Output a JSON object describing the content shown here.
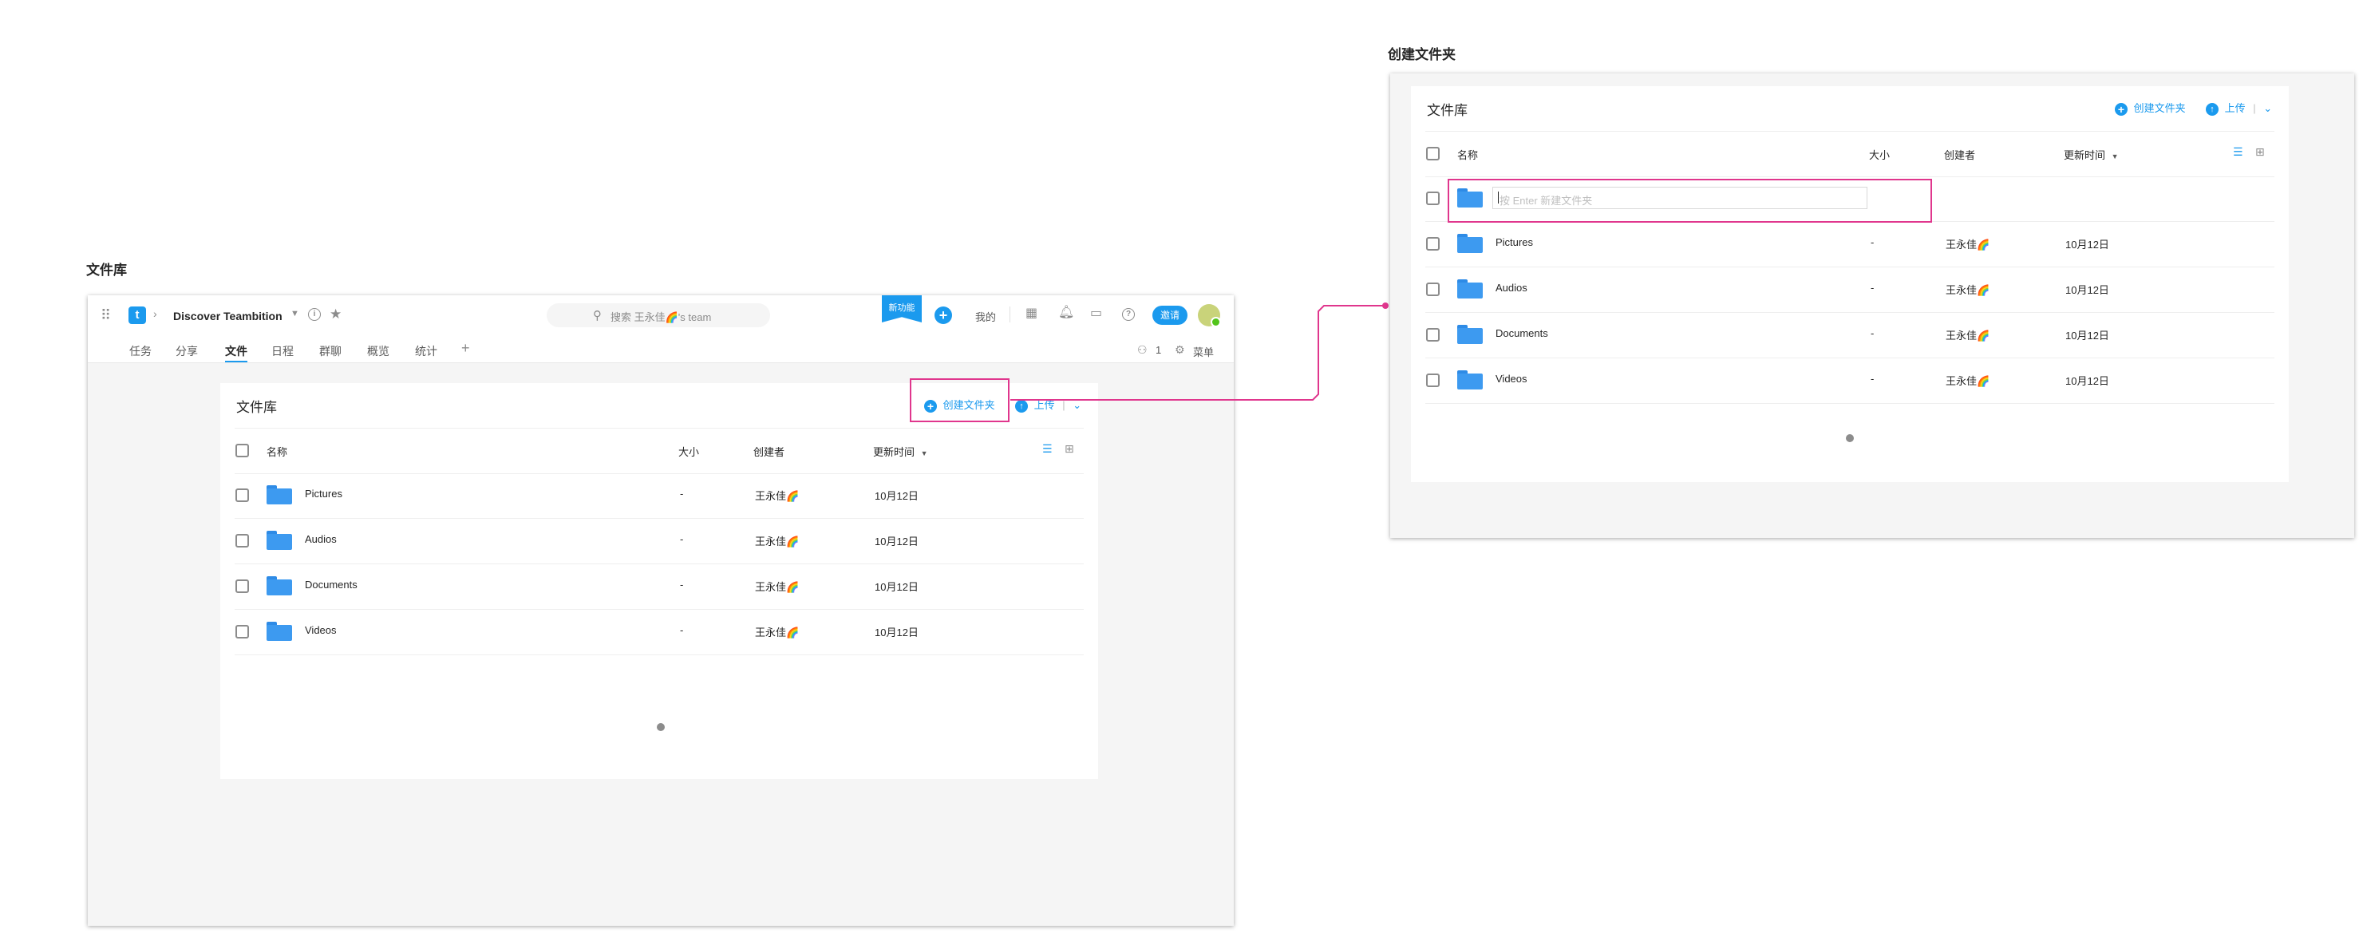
{
  "left_label": "文件库",
  "right_label": "创建文件夹",
  "app": {
    "project_name": "Discover Teambition",
    "search_placeholder": "搜索 王永佳🌈's team",
    "new_feature": "新功能",
    "mine": "我的",
    "invite": "邀请",
    "tabs": [
      "任务",
      "分享",
      "文件",
      "日程",
      "群聊",
      "概览",
      "统计"
    ],
    "member_count": "1",
    "menu": "菜单"
  },
  "library": {
    "title": "文件库",
    "create_folder": "创建文件夹",
    "upload": "上传",
    "columns": {
      "name": "名称",
      "size": "大小",
      "creator": "创建者",
      "updated": "更新时间"
    },
    "rows": [
      {
        "name": "Pictures",
        "size": "-",
        "creator": "王永佳🌈",
        "date": "10月12日"
      },
      {
        "name": "Audios",
        "size": "-",
        "creator": "王永佳🌈",
        "date": "10月12日"
      },
      {
        "name": "Documents",
        "size": "-",
        "creator": "王永佳🌈",
        "date": "10月12日"
      },
      {
        "name": "Videos",
        "size": "-",
        "creator": "王永佳🌈",
        "date": "10月12日"
      }
    ],
    "new_folder_placeholder": "按 Enter 新建文件夹"
  },
  "colors": {
    "accent": "#1b9aee",
    "highlight": "#e0368d",
    "folder": "#3d9af0"
  }
}
